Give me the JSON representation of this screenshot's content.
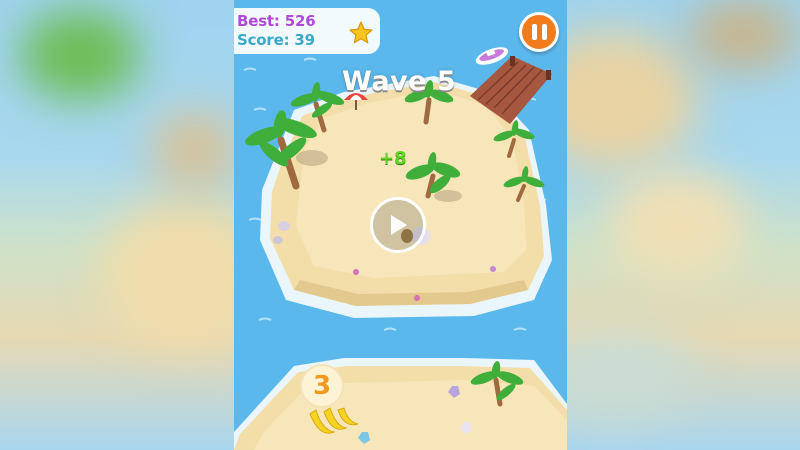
{
  "hud": {
    "best_label": "Best: 526",
    "score_label": "Score: 39",
    "star_icon": "star-icon",
    "pause_icon": "pause-icon"
  },
  "game": {
    "wave_text": "Wave 5",
    "bonus_text": "+8",
    "play_icon": "play-icon",
    "next_level_number": "3"
  },
  "colors": {
    "ocean": "#5bb8ec",
    "sand": "#f3deaa",
    "best_text": "#b04ad6",
    "score_text": "#3aa8c8",
    "pause_button": "#f27c1c",
    "bonus_text": "#63d324",
    "level_number": "#f19a1f"
  }
}
